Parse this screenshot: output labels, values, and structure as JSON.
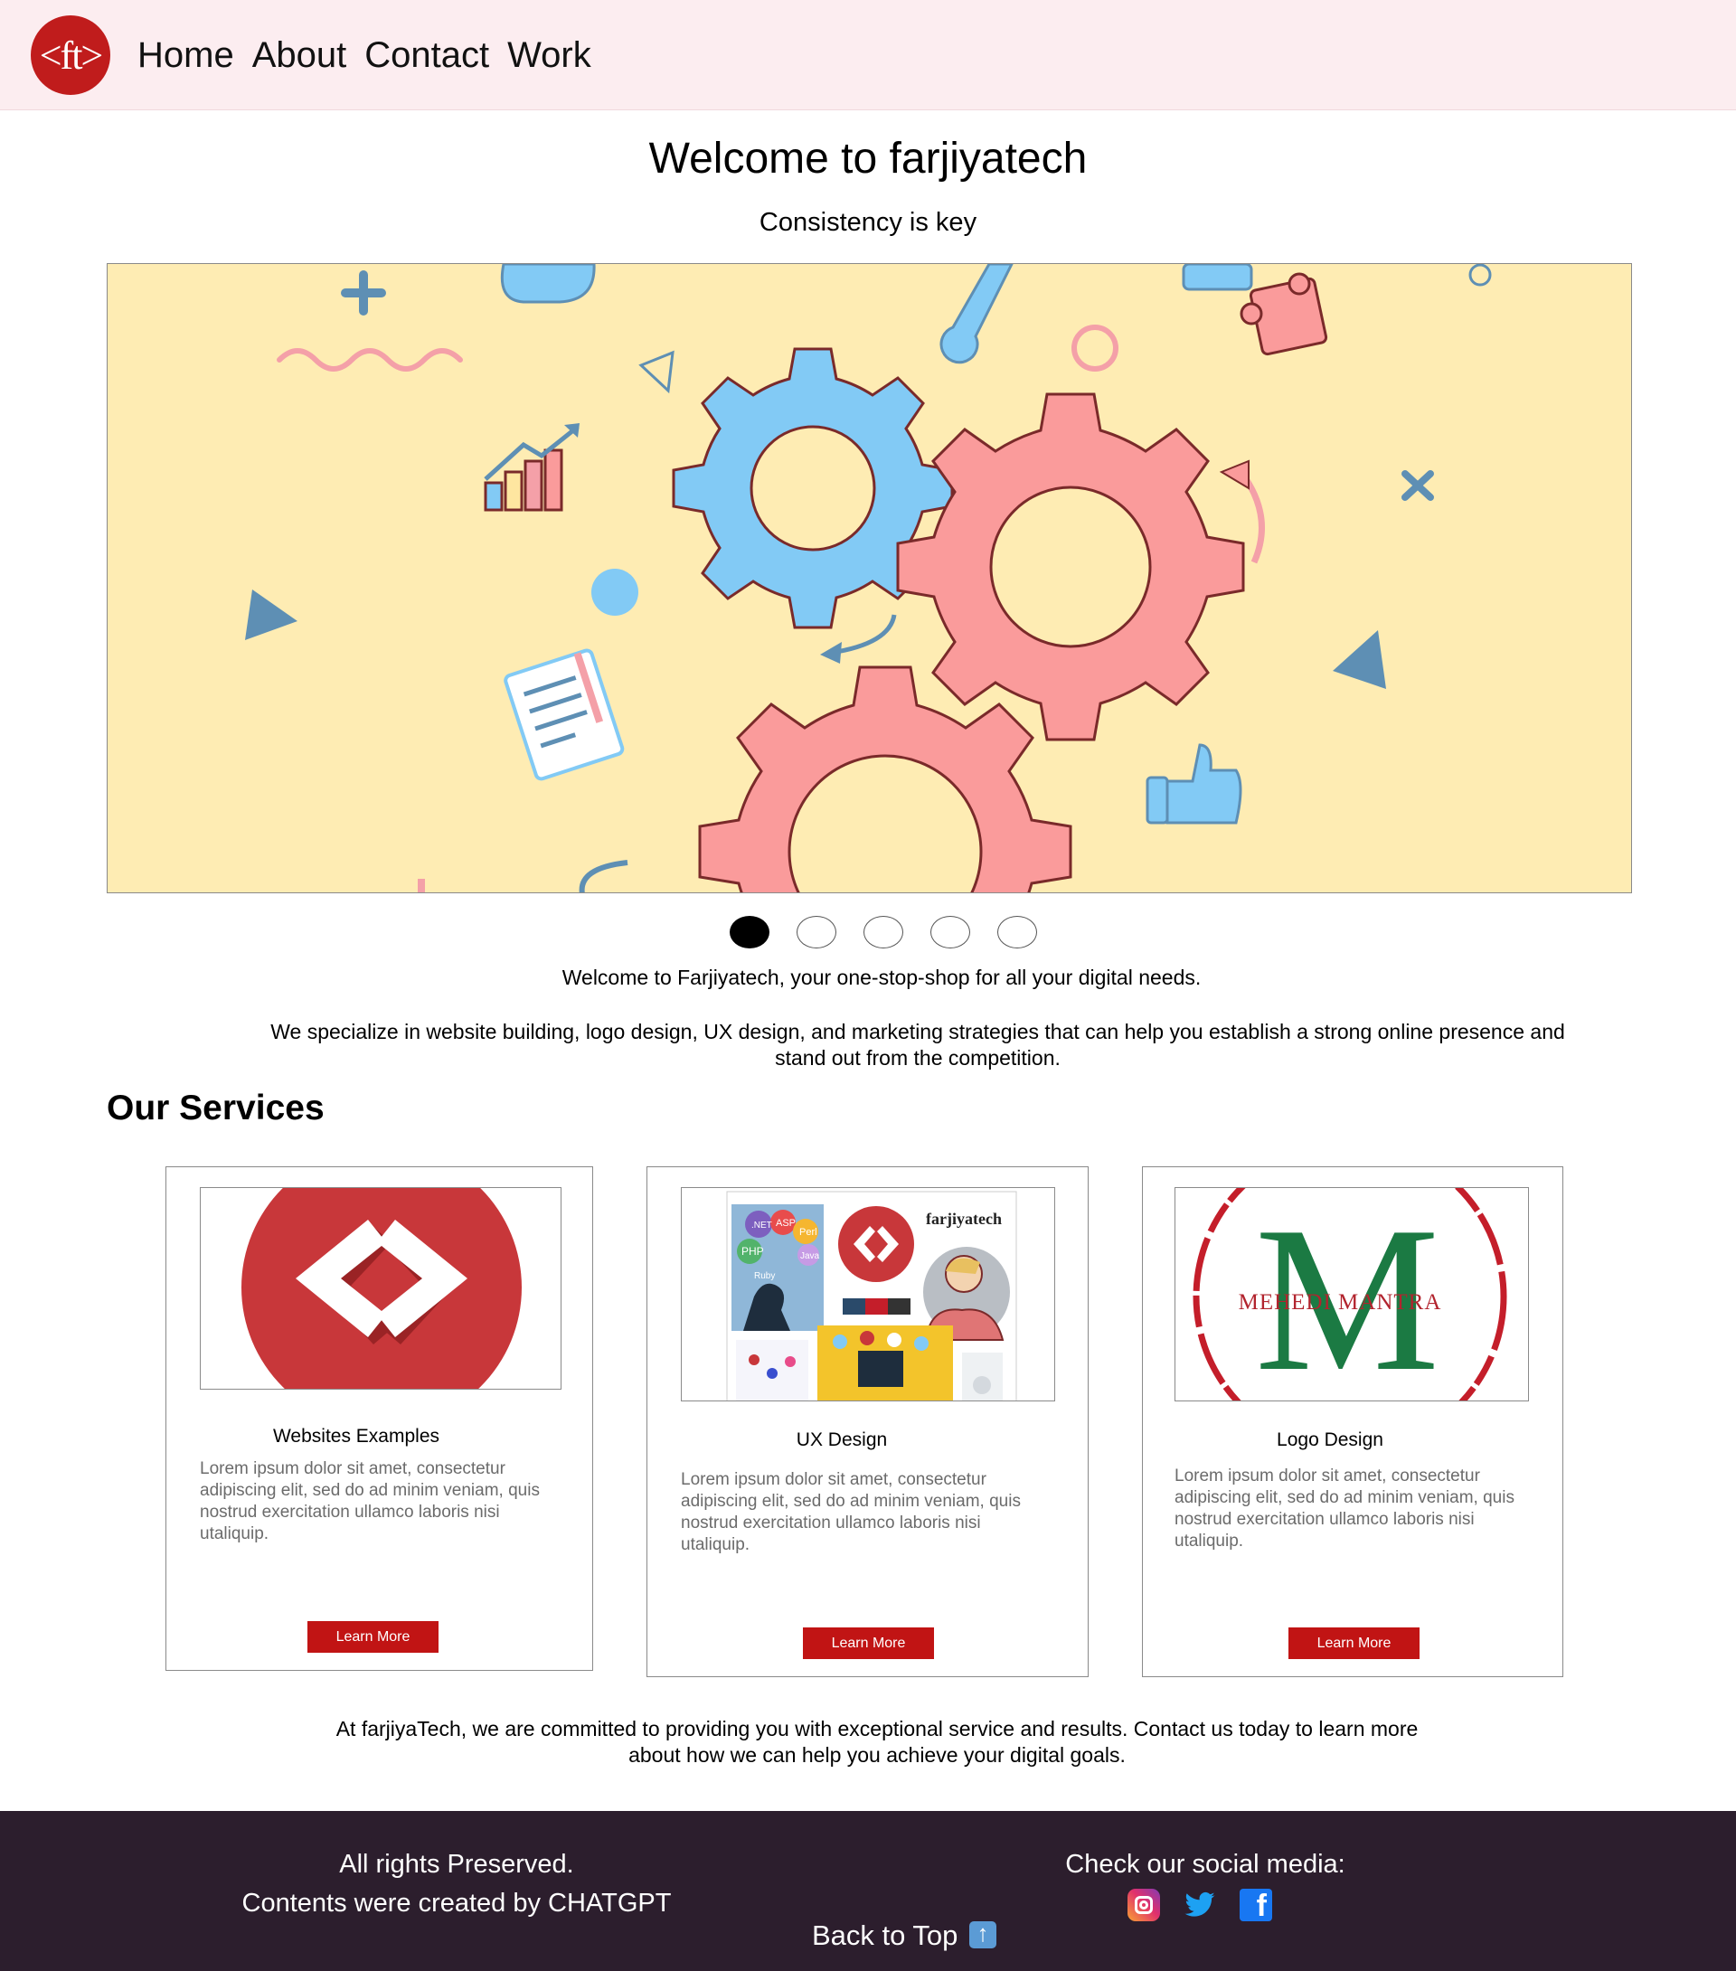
{
  "header": {
    "logo_text": "<ft>",
    "nav": [
      "Home",
      "About",
      "Contact",
      "Work"
    ]
  },
  "hero": {
    "title": "Welcome to farjiyatech",
    "subtitle": "Consistency is key"
  },
  "carousel": {
    "slide_count": 5,
    "active_index": 0
  },
  "intro": {
    "line1": "Welcome to Farjiyatech, your one-stop-shop for all your digital needs.",
    "line2": "We specialize in website building, logo design, UX design, and marketing strategies that can help you establish a strong online presence and stand out from the competition."
  },
  "services": {
    "title": "Our Services",
    "cards": [
      {
        "title": "Websites Examples",
        "text": "Lorem ipsum dolor sit amet, consectetur adipiscing elit, sed do ad minim veniam, quis nostrud exercitation ullamco laboris nisi utaliquip.",
        "button": "Learn More"
      },
      {
        "title": "UX Design",
        "text": "Lorem ipsum dolor sit amet, consectetur adipiscing elit, sed do ad minim veniam, quis nostrud exercitation ullamco laboris nisi utaliquip.",
        "button": "Learn More",
        "image_brand": "farjiyatech",
        "image_tags": [
          ".NET",
          "ASP",
          "Perl",
          "PHP",
          "Java",
          "Ruby"
        ]
      },
      {
        "title": "Logo Design",
        "text": "Lorem ipsum dolor sit amet, consectetur adipiscing elit, sed do ad minim veniam, quis nostrud exercitation ullamco laboris nisi utaliquip.",
        "button": "Learn More",
        "image_text": "MEHEDI MANTRA",
        "image_letter": "M"
      }
    ]
  },
  "closing": "At farjiyaTech, we are committed to providing you with exceptional service and results. Contact us today to learn more about how we can help you achieve your digital goals.",
  "footer": {
    "rights": "All rights Preserved.",
    "credits": "Contents were created by CHATGPT",
    "social_heading": "Check our social media:",
    "back_to_top": "Back to Top",
    "social_icons": [
      "instagram-icon",
      "twitter-icon",
      "facebook-icon"
    ]
  },
  "colors": {
    "header_bg": "#fcedf0",
    "banner_bg": "#feecb3",
    "gear_pink": "#fa9b9b",
    "gear_blue": "#82caf5",
    "accent_red": "#c11414",
    "footer_bg": "#2c1e2d"
  }
}
